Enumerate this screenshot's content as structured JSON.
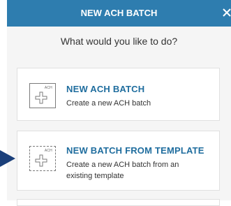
{
  "modal": {
    "title": "NEW ACH BATCH",
    "close_icon": "close-icon",
    "prompt": "What would you like to do?"
  },
  "options": [
    {
      "tag": "ACH",
      "title": "NEW ACH BATCH",
      "description": "Create a new ACH batch",
      "icon": "plus-file-icon"
    },
    {
      "tag": "ACH",
      "title": "NEW BATCH FROM TEMPLATE",
      "description": "Create a new ACH batch from an existing template",
      "icon": "plus-template-icon"
    }
  ],
  "colors": {
    "header": "#2e7daf",
    "title_accent": "#1f6d9e",
    "panel_bg": "#f5f5f5",
    "pointer": "#1a3f7a"
  }
}
